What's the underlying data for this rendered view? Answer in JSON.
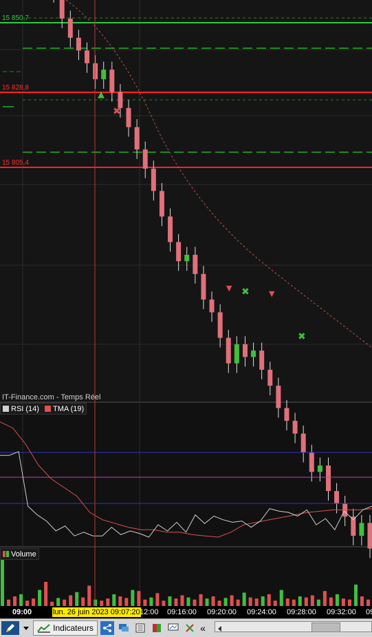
{
  "price_levels": [
    {
      "label": "15 850,7",
      "value": 15850.7,
      "color": "#2ecc40"
    },
    {
      "label": "15 828,8",
      "value": 15828.8,
      "color": "#ff2020"
    },
    {
      "label": "15 805,4",
      "value": 15805.4,
      "color": "#ff2020"
    }
  ],
  "source_label": "IT-Finance.com - Temps Réel",
  "indicator_legend": {
    "rsi_label": "RSI (14)",
    "tma_label": "TMA (19)",
    "rsi_color": "#cfcfcf",
    "tma_color": "#e05050"
  },
  "volume_legend": {
    "label": "Volume",
    "colors": [
      "#e05050",
      "#3fbf3f"
    ]
  },
  "time_axis": {
    "ticks": [
      "09:00",
      "",
      "12:00",
      "09:16:00",
      "09:20:00",
      "09:24:00",
      "09:28:00",
      "09:32:00",
      "09"
    ],
    "cursor_label": "lun. 26 juin 2023 09:07:20"
  },
  "toolbar": {
    "indicators_label": "Indicateurs",
    "collapse_label": "«"
  },
  "colors": {
    "up_candle": "#3fbf3f",
    "down_candle": "#e0707a",
    "cursor": "#b33b3b",
    "rsi_band_blue": "#3333cc",
    "rsi_band_magenta": "#c040c0",
    "cursor_label_bg": "#ffea00"
  },
  "chart_data": [
    {
      "type": "candlestick",
      "title": "",
      "y_levels_printed": [
        15850.7,
        15828.8,
        15805.4
      ],
      "series": [
        {
          "name": "",
          "close_path": [
            15866,
            15860,
            15852,
            15846,
            15842,
            15838,
            15833,
            15836,
            15829,
            15824,
            15818,
            15811,
            15805,
            15798,
            15790,
            15782,
            15776,
            15778,
            15772,
            15764,
            15760,
            15752,
            15744,
            15750,
            15746,
            15748,
            15742,
            15737,
            15730,
            15726,
            15722,
            15716,
            15710,
            15712,
            15704,
            15700,
            15696,
            15690,
            15694,
            15686
          ]
        }
      ]
    },
    {
      "type": "line",
      "title": "",
      "series": [
        {
          "name": "RSI (14)",
          "values": [
            66,
            66,
            69,
            25,
            18,
            13,
            5,
            9,
            1,
            4,
            1,
            1,
            8,
            2,
            5,
            3,
            0,
            10,
            5,
            12,
            4,
            18,
            11,
            17,
            14,
            12,
            13,
            8,
            13,
            23,
            21,
            20,
            17,
            22,
            10,
            15,
            6,
            21,
            14,
            22,
            25
          ]
        },
        {
          "name": "TMA (19)",
          "values": [
            93,
            88,
            75,
            58,
            47,
            40,
            33,
            20,
            14,
            11,
            8,
            6,
            6,
            4,
            4,
            2,
            1,
            0,
            4,
            10,
            12,
            14,
            16,
            18,
            20,
            21,
            22,
            22,
            22,
            23
          ]
        }
      ],
      "bands": [
        75,
        42,
        20
      ]
    },
    {
      "type": "bar",
      "title": "",
      "series": [
        {
          "name": "Volume",
          "values": [
            90,
            12,
            18,
            22,
            10,
            14,
            30,
            45,
            8,
            15,
            12,
            20,
            26,
            16,
            38,
            12,
            10,
            14,
            22,
            18,
            15,
            30,
            28,
            12,
            16,
            24,
            10,
            18,
            14,
            20,
            16,
            12,
            22,
            14,
            18,
            10,
            15,
            20,
            12,
            25,
            16,
            14,
            18,
            22,
            10,
            30,
            14,
            12,
            18,
            16,
            20,
            12,
            28,
            16,
            22,
            14,
            12,
            40,
            18,
            12
          ]
        }
      ]
    }
  ]
}
